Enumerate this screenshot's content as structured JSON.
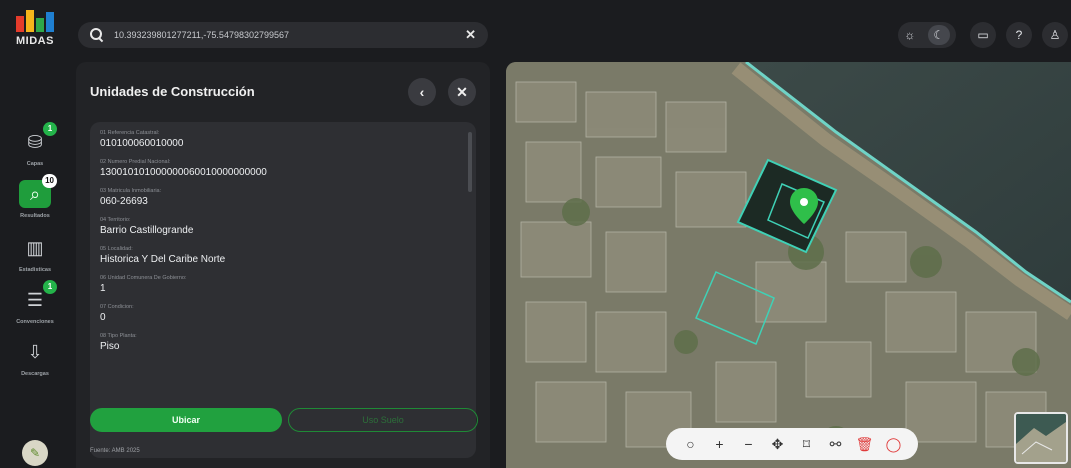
{
  "app": {
    "logo_text": "MIDAS",
    "accent": "#21a13f"
  },
  "sidebar": {
    "items": [
      {
        "label": "Capas",
        "icon": "layers-icon",
        "badge": "1",
        "glyph": "⛁"
      },
      {
        "label": "Resultados",
        "icon": "results-icon",
        "badge": "10",
        "glyph": "⌕"
      },
      {
        "label": "Estadisticas",
        "icon": "stats-icon",
        "badge": "",
        "glyph": "▥"
      },
      {
        "label": "Convenciones",
        "icon": "list-icon",
        "badge": "1",
        "glyph": "☰"
      },
      {
        "label": "Descargas",
        "icon": "download-icon",
        "badge": "",
        "glyph": "⇩"
      }
    ]
  },
  "search": {
    "value": "10.393239801277211,-75.54798302799567",
    "clear": "✕"
  },
  "top_controls": {
    "sun": "☼",
    "moon": "☾",
    "chat": "▭",
    "help": "?",
    "user": "♙"
  },
  "panel": {
    "title": "Unidades de Construcción",
    "back": "‹",
    "close": "✕",
    "fields": [
      {
        "label": "01 Referencia Catastral:",
        "value": "010100060010000"
      },
      {
        "label": "02 Numero Predial Nacional:",
        "value": "130010101000000060010000000000"
      },
      {
        "label": "03 Matricula Inmobiliaria:",
        "value": "060-26693"
      },
      {
        "label": "04 Territorio:",
        "value": "Barrio Castillogrande"
      },
      {
        "label": "05 Localidad:",
        "value": "Historica Y Del Caribe Norte"
      },
      {
        "label": "06 Unidad Comunera De Gobierno:",
        "value": "1"
      },
      {
        "label": "07 Condicion:",
        "value": "0"
      },
      {
        "label": "08 Tipo Planta:",
        "value": "Piso"
      }
    ],
    "primary_button": "Ubicar",
    "secondary_button": "Uso Suelo",
    "footer": "Fuente: AMB 2025"
  },
  "map_toolbar": {
    "tools": [
      {
        "name": "point-tool",
        "glyph": "○"
      },
      {
        "name": "zoom-in-tool",
        "glyph": "+"
      },
      {
        "name": "zoom-out-tool",
        "glyph": "−"
      },
      {
        "name": "pan-tool",
        "glyph": "✥"
      },
      {
        "name": "polygon-tool",
        "glyph": "⌑"
      },
      {
        "name": "measure-tool",
        "glyph": "⚯"
      },
      {
        "name": "delete-tool",
        "glyph": "🗑"
      },
      {
        "name": "reset-tool",
        "glyph": "◯"
      }
    ]
  }
}
